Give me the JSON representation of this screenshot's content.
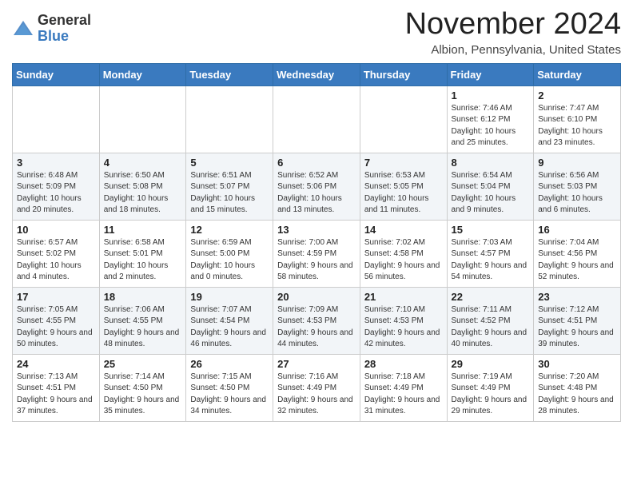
{
  "logo": {
    "general": "General",
    "blue": "Blue"
  },
  "header": {
    "month": "November 2024",
    "location": "Albion, Pennsylvania, United States"
  },
  "weekdays": [
    "Sunday",
    "Monday",
    "Tuesday",
    "Wednesday",
    "Thursday",
    "Friday",
    "Saturday"
  ],
  "weeks": [
    [
      {
        "day": "",
        "info": ""
      },
      {
        "day": "",
        "info": ""
      },
      {
        "day": "",
        "info": ""
      },
      {
        "day": "",
        "info": ""
      },
      {
        "day": "",
        "info": ""
      },
      {
        "day": "1",
        "info": "Sunrise: 7:46 AM\nSunset: 6:12 PM\nDaylight: 10 hours and 25 minutes."
      },
      {
        "day": "2",
        "info": "Sunrise: 7:47 AM\nSunset: 6:10 PM\nDaylight: 10 hours and 23 minutes."
      }
    ],
    [
      {
        "day": "3",
        "info": "Sunrise: 6:48 AM\nSunset: 5:09 PM\nDaylight: 10 hours and 20 minutes."
      },
      {
        "day": "4",
        "info": "Sunrise: 6:50 AM\nSunset: 5:08 PM\nDaylight: 10 hours and 18 minutes."
      },
      {
        "day": "5",
        "info": "Sunrise: 6:51 AM\nSunset: 5:07 PM\nDaylight: 10 hours and 15 minutes."
      },
      {
        "day": "6",
        "info": "Sunrise: 6:52 AM\nSunset: 5:06 PM\nDaylight: 10 hours and 13 minutes."
      },
      {
        "day": "7",
        "info": "Sunrise: 6:53 AM\nSunset: 5:05 PM\nDaylight: 10 hours and 11 minutes."
      },
      {
        "day": "8",
        "info": "Sunrise: 6:54 AM\nSunset: 5:04 PM\nDaylight: 10 hours and 9 minutes."
      },
      {
        "day": "9",
        "info": "Sunrise: 6:56 AM\nSunset: 5:03 PM\nDaylight: 10 hours and 6 minutes."
      }
    ],
    [
      {
        "day": "10",
        "info": "Sunrise: 6:57 AM\nSunset: 5:02 PM\nDaylight: 10 hours and 4 minutes."
      },
      {
        "day": "11",
        "info": "Sunrise: 6:58 AM\nSunset: 5:01 PM\nDaylight: 10 hours and 2 minutes."
      },
      {
        "day": "12",
        "info": "Sunrise: 6:59 AM\nSunset: 5:00 PM\nDaylight: 10 hours and 0 minutes."
      },
      {
        "day": "13",
        "info": "Sunrise: 7:00 AM\nSunset: 4:59 PM\nDaylight: 9 hours and 58 minutes."
      },
      {
        "day": "14",
        "info": "Sunrise: 7:02 AM\nSunset: 4:58 PM\nDaylight: 9 hours and 56 minutes."
      },
      {
        "day": "15",
        "info": "Sunrise: 7:03 AM\nSunset: 4:57 PM\nDaylight: 9 hours and 54 minutes."
      },
      {
        "day": "16",
        "info": "Sunrise: 7:04 AM\nSunset: 4:56 PM\nDaylight: 9 hours and 52 minutes."
      }
    ],
    [
      {
        "day": "17",
        "info": "Sunrise: 7:05 AM\nSunset: 4:55 PM\nDaylight: 9 hours and 50 minutes."
      },
      {
        "day": "18",
        "info": "Sunrise: 7:06 AM\nSunset: 4:55 PM\nDaylight: 9 hours and 48 minutes."
      },
      {
        "day": "19",
        "info": "Sunrise: 7:07 AM\nSunset: 4:54 PM\nDaylight: 9 hours and 46 minutes."
      },
      {
        "day": "20",
        "info": "Sunrise: 7:09 AM\nSunset: 4:53 PM\nDaylight: 9 hours and 44 minutes."
      },
      {
        "day": "21",
        "info": "Sunrise: 7:10 AM\nSunset: 4:53 PM\nDaylight: 9 hours and 42 minutes."
      },
      {
        "day": "22",
        "info": "Sunrise: 7:11 AM\nSunset: 4:52 PM\nDaylight: 9 hours and 40 minutes."
      },
      {
        "day": "23",
        "info": "Sunrise: 7:12 AM\nSunset: 4:51 PM\nDaylight: 9 hours and 39 minutes."
      }
    ],
    [
      {
        "day": "24",
        "info": "Sunrise: 7:13 AM\nSunset: 4:51 PM\nDaylight: 9 hours and 37 minutes."
      },
      {
        "day": "25",
        "info": "Sunrise: 7:14 AM\nSunset: 4:50 PM\nDaylight: 9 hours and 35 minutes."
      },
      {
        "day": "26",
        "info": "Sunrise: 7:15 AM\nSunset: 4:50 PM\nDaylight: 9 hours and 34 minutes."
      },
      {
        "day": "27",
        "info": "Sunrise: 7:16 AM\nSunset: 4:49 PM\nDaylight: 9 hours and 32 minutes."
      },
      {
        "day": "28",
        "info": "Sunrise: 7:18 AM\nSunset: 4:49 PM\nDaylight: 9 hours and 31 minutes."
      },
      {
        "day": "29",
        "info": "Sunrise: 7:19 AM\nSunset: 4:49 PM\nDaylight: 9 hours and 29 minutes."
      },
      {
        "day": "30",
        "info": "Sunrise: 7:20 AM\nSunset: 4:48 PM\nDaylight: 9 hours and 28 minutes."
      }
    ]
  ]
}
